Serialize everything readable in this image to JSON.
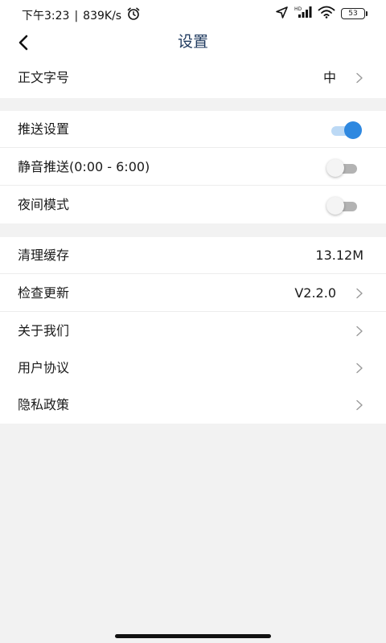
{
  "status_bar": {
    "time": "下午3:23",
    "separator": "|",
    "network_speed": "839K/s",
    "battery_level": "53",
    "icons": [
      "alarm-icon",
      "location-icon",
      "signal-icon",
      "wifi-icon",
      "battery-icon"
    ]
  },
  "header": {
    "title": "设置",
    "back_icon": "chevron-left-icon"
  },
  "groups": [
    {
      "items": [
        {
          "label": "正文字号",
          "value": "中",
          "control": "chevron"
        }
      ]
    },
    {
      "items": [
        {
          "label": "推送设置",
          "control": "toggle",
          "on": true
        },
        {
          "label": "静音推送(0:00 - 6:00)",
          "control": "toggle",
          "on": false
        },
        {
          "label": "夜间模式",
          "control": "toggle",
          "on": false
        }
      ]
    },
    {
      "items": [
        {
          "label": "清理缓存",
          "value": "13.12M",
          "control": "none"
        },
        {
          "label": "检查更新",
          "value": "V2.2.0",
          "control": "chevron"
        },
        {
          "label": "关于我们",
          "control": "chevron"
        },
        {
          "label": "用户协议",
          "control": "chevron"
        },
        {
          "label": "隐私政策",
          "control": "chevron"
        }
      ]
    }
  ],
  "colors": {
    "accent": "#2e88e0",
    "title": "#1f3a5f",
    "background": "#f2f2f2"
  }
}
